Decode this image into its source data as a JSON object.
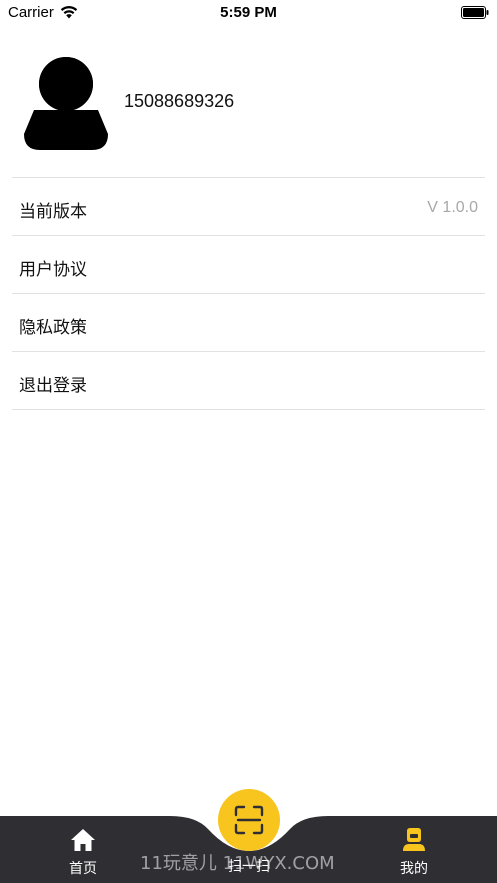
{
  "status_bar": {
    "carrier": "Carrier",
    "time": "5:59 PM",
    "wifi_icon": "wifi-icon",
    "battery_icon": "battery-icon"
  },
  "profile": {
    "avatar_icon": "user-silhouette-icon",
    "phone": "15088689326"
  },
  "menu": {
    "items": [
      {
        "label": "当前版本",
        "value": "V 1.0.0"
      },
      {
        "label": "用户协议"
      },
      {
        "label": "隐私政策"
      },
      {
        "label": "退出登录"
      }
    ]
  },
  "tab_bar": {
    "home_label": "首页",
    "scan_label": "扫一扫",
    "mine_label": "我的",
    "active_tab": "我的",
    "active_color": "#f8c51f",
    "bar_color": "#2e2e33",
    "home_icon": "home-icon",
    "scan_icon": "scan-icon",
    "mine_icon": "user-icon"
  },
  "watermark": "11玩意儿 11WYX.COM"
}
